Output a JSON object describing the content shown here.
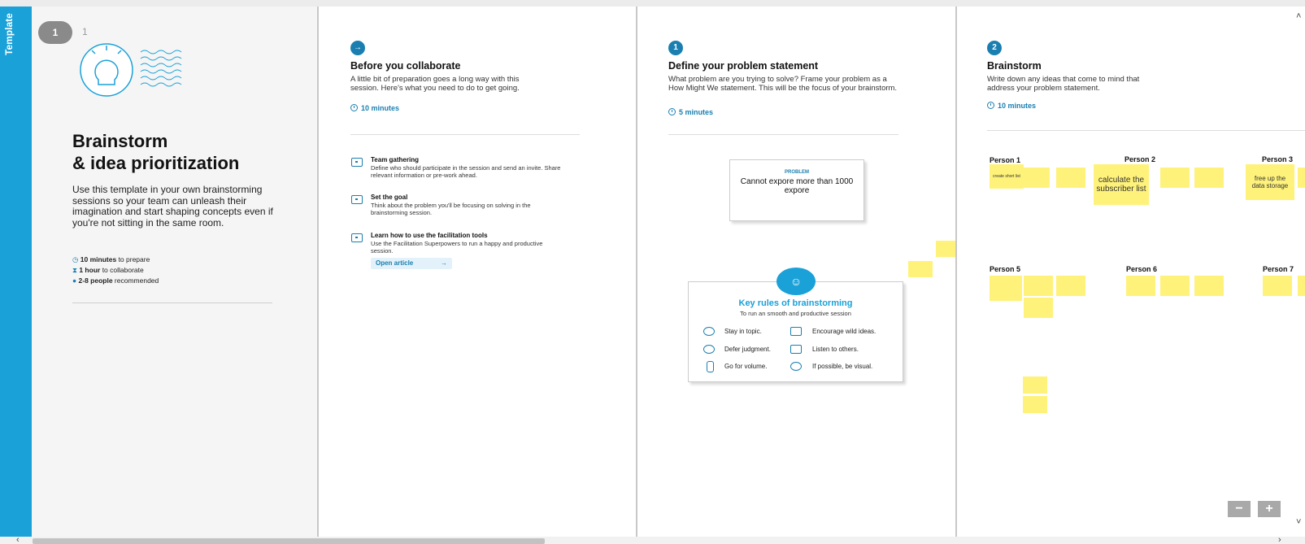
{
  "sidebar": {
    "template_label": "Template"
  },
  "pager": {
    "current": "1",
    "total": "1"
  },
  "intro": {
    "title_line1": "Brainstorm",
    "title_line2": "& idea prioritization",
    "description": "Use this template in your own brainstorming sessions so your team can unleash their imagination and start shaping concepts even if you're not sitting in the same room.",
    "meta": [
      {
        "bold": "10 minutes",
        "rest": " to prepare",
        "icon": "clock-icon"
      },
      {
        "bold": "1 hour",
        "rest": " to collaborate",
        "icon": "hourglass-icon"
      },
      {
        "bold": "2-8 people",
        "rest": " recommended",
        "icon": "person-icon"
      }
    ]
  },
  "before": {
    "badge": "→",
    "title": "Before you collaborate",
    "desc": "A little bit of preparation goes a long way with this session. Here's what you need to do to get going.",
    "time": "10 minutes",
    "steps": [
      {
        "title": "Team gathering",
        "desc": "Define who should participate in the session and send an invite. Share relevant information or pre-work ahead."
      },
      {
        "title": "Set the goal",
        "desc": "Think about the problem you'll be focusing on solving in the brainstorming session."
      },
      {
        "title": "Learn how to use the facilitation tools",
        "desc": "Use the Facilitation Superpowers to run a happy and productive session."
      }
    ],
    "open_article": "Open article",
    "open_arrow": "→"
  },
  "define": {
    "badge": "1",
    "title": "Define your problem statement",
    "desc": "What problem are you trying to solve? Frame your problem as a How Might We statement. This will be the focus of your brainstorm.",
    "time": "5 minutes",
    "problem_label": "PROBLEM",
    "problem_text": "Cannot expore more than 1000 expore",
    "rules_title": "Key rules of brainstorming",
    "rules_sub": "To run an smooth and productive session",
    "rules": [
      "Stay in topic.",
      "Encourage wild ideas.",
      "Defer judgment.",
      "Listen to others.",
      "Go for volume.",
      "If possible, be visual."
    ]
  },
  "brainstorm": {
    "badge": "2",
    "title": "Brainstorm",
    "desc": "Write down any ideas that come to mind that address your problem statement.",
    "time": "10 minutes",
    "persons": [
      "Person 1",
      "Person 2",
      "Person 3",
      "Person 5",
      "Person 6",
      "Person 7"
    ],
    "notes": [
      "create short list",
      "calculate the subscriber list",
      "free up the data storage"
    ]
  },
  "zoom": {
    "minus": "−",
    "plus": "+"
  },
  "colors": {
    "accent": "#1aa1d8",
    "sticky": "#fff27a"
  }
}
